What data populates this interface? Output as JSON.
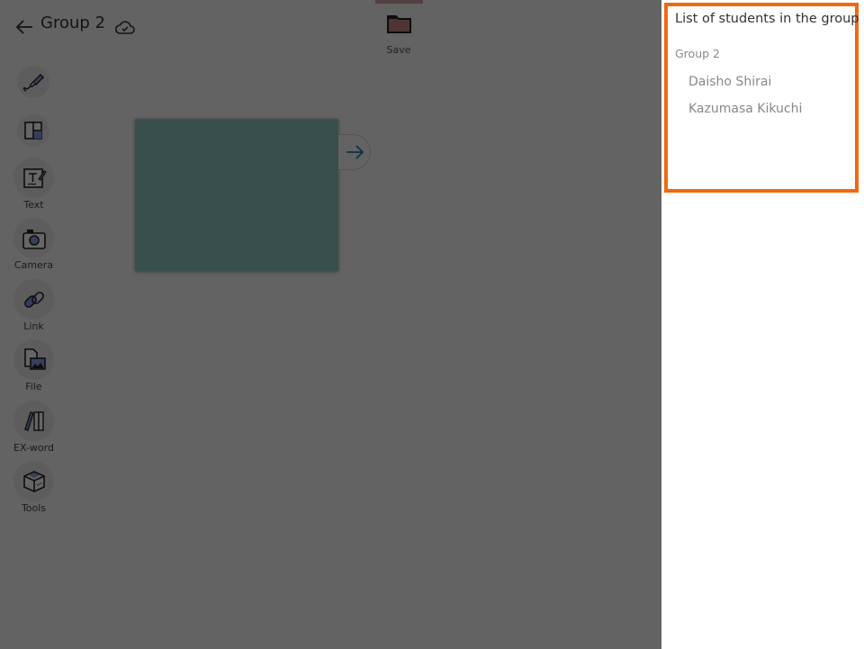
{
  "header": {
    "title": "Group 2",
    "back_icon": "arrow-left-icon",
    "sync_icon": "cloud-check-icon"
  },
  "toolbar": {
    "save_label": "Save",
    "save_icon": "folder-icon"
  },
  "tools": [
    {
      "name": "pen",
      "label": "",
      "icon": "pen-icon"
    },
    {
      "name": "layout",
      "label": "",
      "icon": "layout-icon"
    },
    {
      "name": "text",
      "label": "Text",
      "icon": "text-edit-icon"
    },
    {
      "name": "camera",
      "label": "Camera",
      "icon": "camera-icon"
    },
    {
      "name": "link",
      "label": "Link",
      "icon": "link-icon"
    },
    {
      "name": "file",
      "label": "File",
      "icon": "file-image-icon"
    },
    {
      "name": "ex-word",
      "label": "EX-word",
      "icon": "books-icon"
    },
    {
      "name": "tools",
      "label": "Tools",
      "icon": "toolbox-icon"
    }
  ],
  "canvas": {
    "card_color": "#8fc5c2",
    "next_icon": "arrow-right-icon"
  },
  "panel": {
    "title": "List of students in the group",
    "group": "Group 2",
    "students": [
      "Daisho Shirai",
      "Kazumasa Kikuchi"
    ],
    "highlight_color": "#f0690f"
  }
}
